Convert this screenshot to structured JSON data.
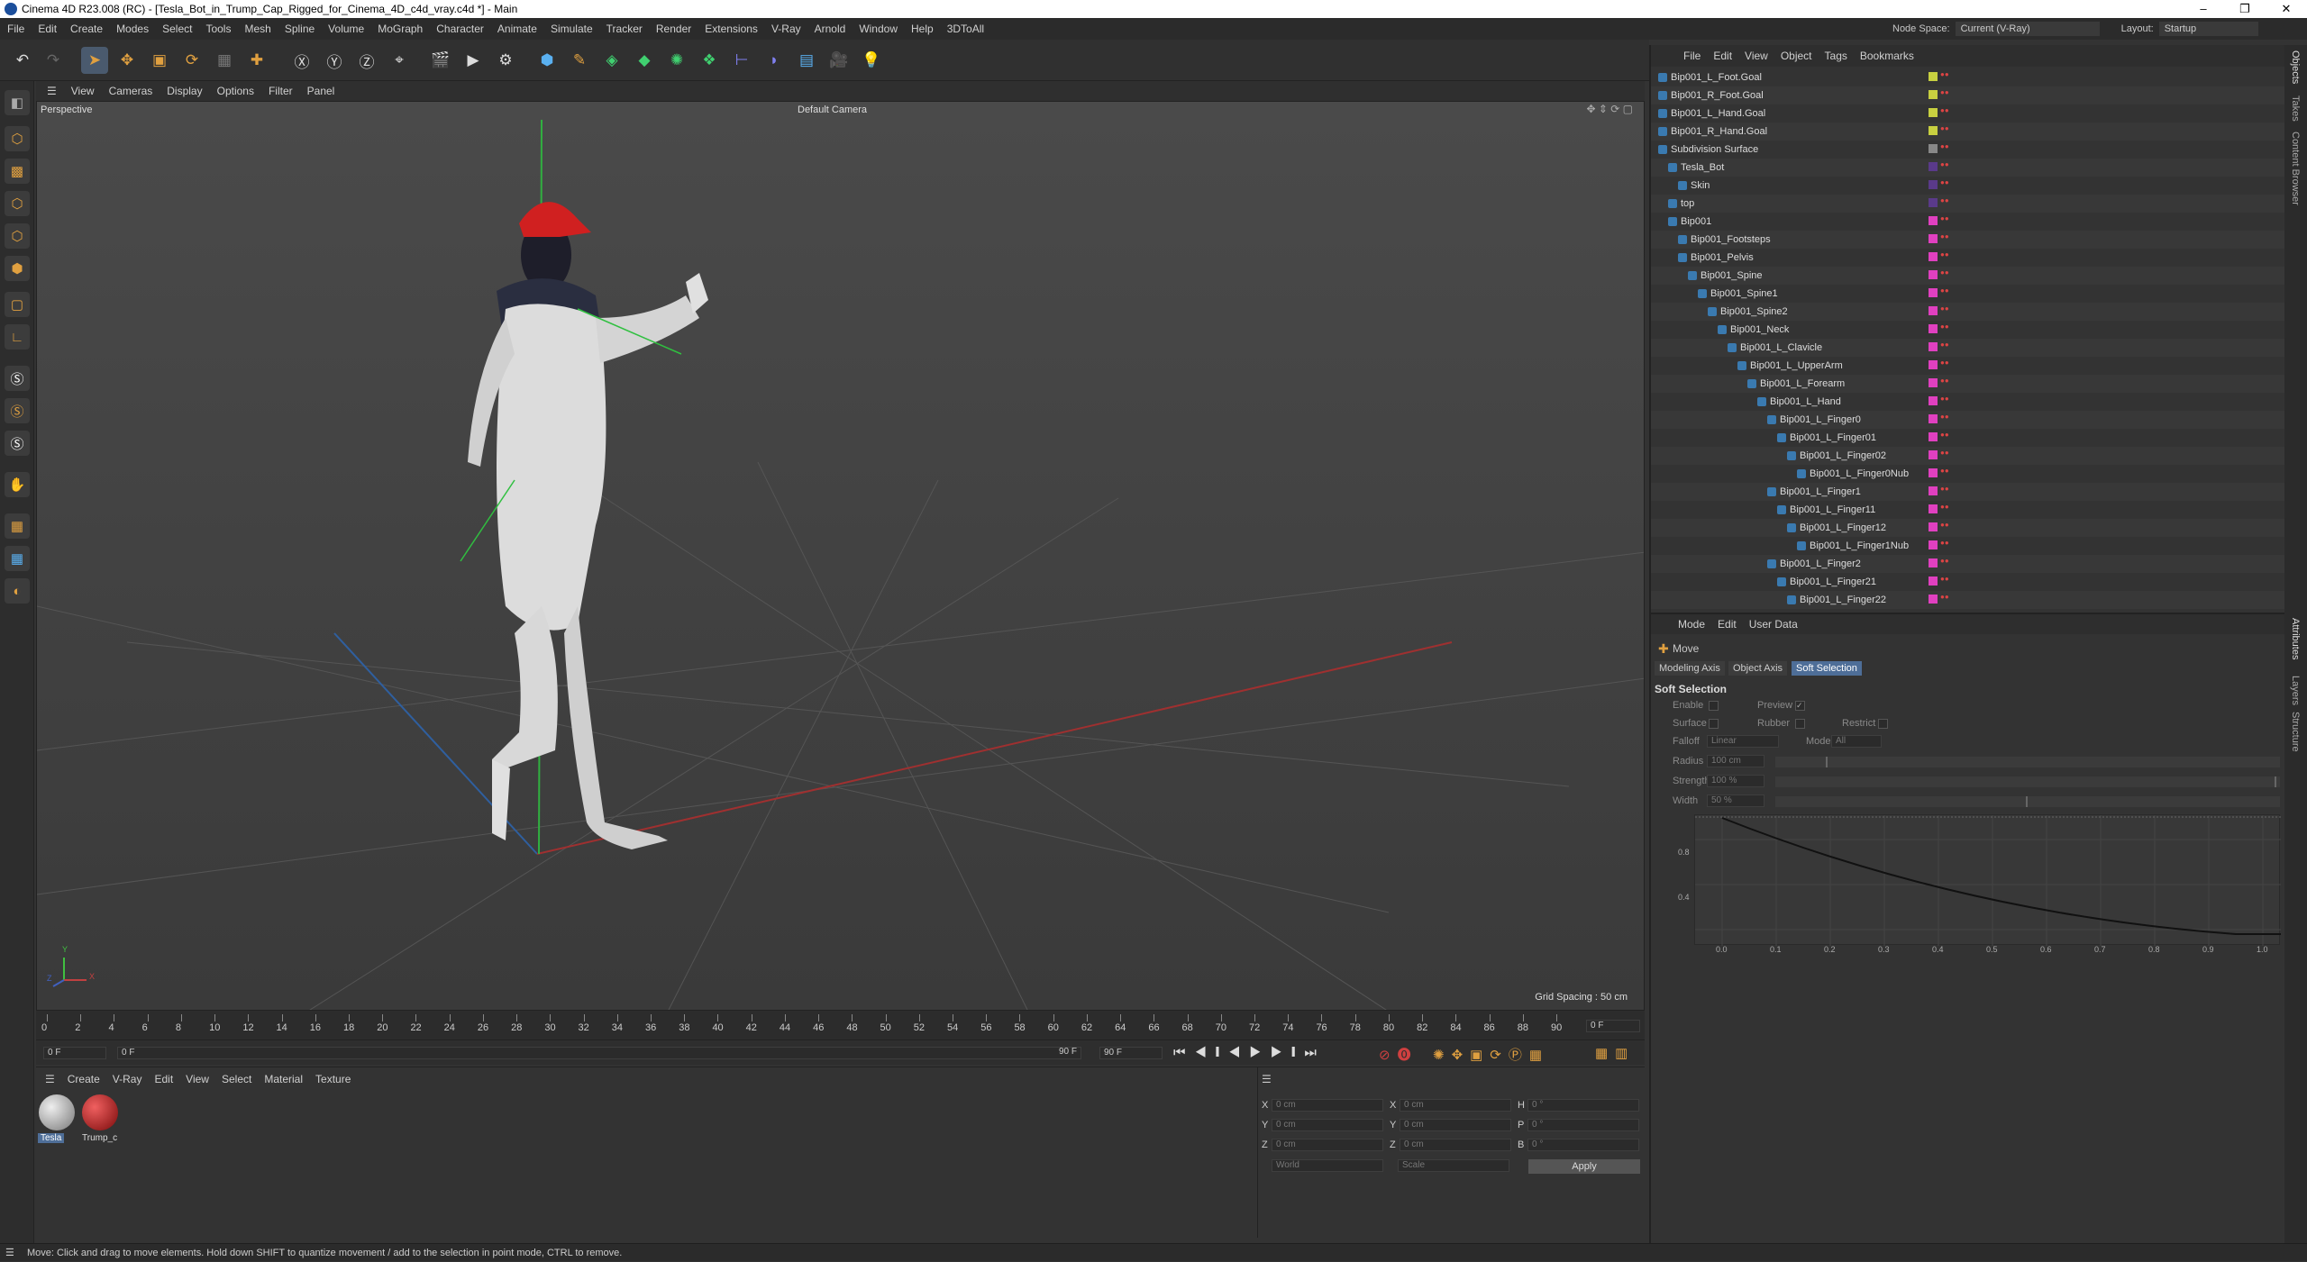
{
  "app": {
    "title": "Cinema 4D R23.008 (RC) - [Tesla_Bot_in_Trump_Cap_Rigged_for_Cinema_4D_c4d_vray.c4d *] - Main"
  },
  "menus": [
    "File",
    "Edit",
    "Create",
    "Modes",
    "Select",
    "Tools",
    "Mesh",
    "Spline",
    "Volume",
    "MoGraph",
    "Character",
    "Animate",
    "Simulate",
    "Tracker",
    "Render",
    "Extensions",
    "V-Ray",
    "Arnold",
    "Window",
    "Help",
    "3DToAll"
  ],
  "top_right": {
    "node_space_label": "Node Space:",
    "node_space_value": "Current (V-Ray)",
    "layout_label": "Layout:",
    "layout_value": "Startup"
  },
  "viewport": {
    "menu": [
      "View",
      "Cameras",
      "Display",
      "Options",
      "Filter",
      "Panel"
    ],
    "name": "Perspective",
    "camera": "Default Camera",
    "grid_spacing": "Grid Spacing : 50 cm",
    "axis_x": "X",
    "axis_y": "Y",
    "axis_z": "Z"
  },
  "timeline": {
    "ticks": [
      "0",
      "2",
      "4",
      "6",
      "8",
      "10",
      "12",
      "14",
      "16",
      "18",
      "20",
      "22",
      "24",
      "26",
      "28",
      "30",
      "32",
      "34",
      "36",
      "38",
      "40",
      "42",
      "44",
      "46",
      "48",
      "50",
      "52",
      "54",
      "56",
      "58",
      "60",
      "62",
      "64",
      "66",
      "68",
      "70",
      "72",
      "74",
      "76",
      "78",
      "80",
      "82",
      "84",
      "86",
      "88",
      "90"
    ],
    "current_frame": "0 F",
    "start": "0 F",
    "range_start": "0 F",
    "range_end": "90 F",
    "end": "90 F"
  },
  "materials": {
    "menu": [
      "Create",
      "V-Ray",
      "Edit",
      "View",
      "Select",
      "Material",
      "Texture"
    ],
    "items": [
      "Tesla",
      "Trump_c"
    ]
  },
  "coords": {
    "labels": [
      "X",
      "Y",
      "Z",
      "X",
      "Y",
      "Z",
      "H",
      "P",
      "B"
    ],
    "values": [
      "0 cm",
      "0 cm",
      "0 cm",
      "0 cm",
      "0 cm",
      "0 cm",
      "0 °",
      "0 °",
      "0 °"
    ],
    "world": "World",
    "scale": "Scale",
    "apply": "Apply"
  },
  "objects": {
    "menu": [
      "File",
      "Edit",
      "View",
      "Object",
      "Tags",
      "Bookmarks"
    ],
    "rows": [
      {
        "name": "Bip001_L_Foot.Goal",
        "indent": 0,
        "color": "#c8d040"
      },
      {
        "name": "Bip001_R_Foot.Goal",
        "indent": 0,
        "color": "#c8d040"
      },
      {
        "name": "Bip001_L_Hand.Goal",
        "indent": 0,
        "color": "#c8d040"
      },
      {
        "name": "Bip001_R_Hand.Goal",
        "indent": 0,
        "color": "#c8d040"
      },
      {
        "name": "Subdivision Surface",
        "indent": 0,
        "color": "#888"
      },
      {
        "name": "Tesla_Bot",
        "indent": 1,
        "color": "#5a3a8a"
      },
      {
        "name": "Skin",
        "indent": 2,
        "color": "#5a3a8a"
      },
      {
        "name": "top",
        "indent": 1,
        "color": "#5a3a8a"
      },
      {
        "name": "Bip001",
        "indent": 1,
        "color": "#e040c0"
      },
      {
        "name": "Bip001_Footsteps",
        "indent": 2,
        "color": "#e040c0"
      },
      {
        "name": "Bip001_Pelvis",
        "indent": 2,
        "color": "#e040c0"
      },
      {
        "name": "Bip001_Spine",
        "indent": 3,
        "color": "#e040c0"
      },
      {
        "name": "Bip001_Spine1",
        "indent": 4,
        "color": "#e040c0"
      },
      {
        "name": "Bip001_Spine2",
        "indent": 5,
        "color": "#e040c0"
      },
      {
        "name": "Bip001_Neck",
        "indent": 6,
        "color": "#e040c0"
      },
      {
        "name": "Bip001_L_Clavicle",
        "indent": 7,
        "color": "#e040c0"
      },
      {
        "name": "Bip001_L_UpperArm",
        "indent": 8,
        "color": "#e040c0"
      },
      {
        "name": "Bip001_L_Forearm",
        "indent": 9,
        "color": "#e040c0"
      },
      {
        "name": "Bip001_L_Hand",
        "indent": 10,
        "color": "#e040c0"
      },
      {
        "name": "Bip001_L_Finger0",
        "indent": 11,
        "color": "#e040c0"
      },
      {
        "name": "Bip001_L_Finger01",
        "indent": 12,
        "color": "#e040c0"
      },
      {
        "name": "Bip001_L_Finger02",
        "indent": 13,
        "color": "#e040c0"
      },
      {
        "name": "Bip001_L_Finger0Nub",
        "indent": 14,
        "color": "#e040c0"
      },
      {
        "name": "Bip001_L_Finger1",
        "indent": 11,
        "color": "#e040c0"
      },
      {
        "name": "Bip001_L_Finger11",
        "indent": 12,
        "color": "#e040c0"
      },
      {
        "name": "Bip001_L_Finger12",
        "indent": 13,
        "color": "#e040c0"
      },
      {
        "name": "Bip001_L_Finger1Nub",
        "indent": 14,
        "color": "#e040c0"
      },
      {
        "name": "Bip001_L_Finger2",
        "indent": 11,
        "color": "#e040c0"
      },
      {
        "name": "Bip001_L_Finger21",
        "indent": 12,
        "color": "#e040c0"
      },
      {
        "name": "Bip001_L_Finger22",
        "indent": 13,
        "color": "#e040c0"
      }
    ]
  },
  "attributes": {
    "menu": [
      "Mode",
      "Edit",
      "User Data"
    ],
    "tool": "Move",
    "tabs": [
      "Modeling Axis",
      "Object Axis",
      "Soft Selection"
    ],
    "active_tab": "Soft Selection",
    "section": "Soft Selection",
    "enable": "Enable",
    "preview": "Preview",
    "surface": "Surface",
    "rubber": "Rubber",
    "restrict": "Restrict",
    "falloff": "Falloff",
    "falloff_value": "Linear",
    "mode": "Mode",
    "mode_value": "All",
    "radius": "Radius",
    "radius_value": "100 cm",
    "strength": "Strength",
    "strength_value": "100 %",
    "width": "Width",
    "width_value": "50 %",
    "graph_y": [
      "0.8",
      "0.4"
    ],
    "graph_x": [
      "0.0",
      "0.1",
      "0.2",
      "0.3",
      "0.4",
      "0.5",
      "0.6",
      "0.7",
      "0.8",
      "0.9",
      "1.0"
    ]
  },
  "side_tabs_top": [
    "Objects",
    "Takes",
    "Content Browser"
  ],
  "side_tabs_bottom": [
    "Attributes",
    "Layers",
    "Structure"
  ],
  "status": "Move: Click and drag to move elements. Hold down SHIFT to quantize movement / add to the selection in point mode, CTRL to remove."
}
